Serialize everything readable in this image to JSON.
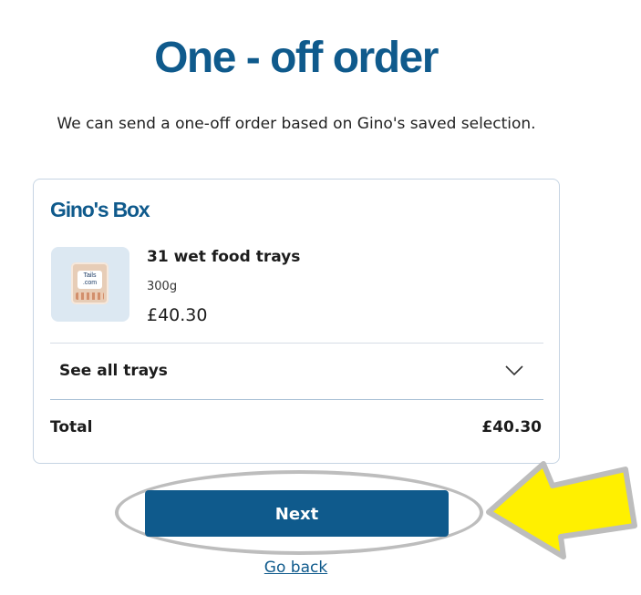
{
  "page": {
    "title": "One - off order",
    "subtitle": "We can send a one-off order based on Gino's saved selection."
  },
  "card": {
    "box_title": "Gino's Box",
    "product": {
      "name": "31 wet food trays",
      "weight": "300g",
      "price": "£40.30",
      "thumbnail_text": "Tails .com"
    },
    "see_all_label": "See all trays",
    "total_label": "Total",
    "total_value": "£40.30"
  },
  "actions": {
    "next_label": "Next",
    "go_back_label": "Go back"
  },
  "annotations": {
    "highlight_color": "#bdbdbd",
    "arrow_color": "#fff000"
  },
  "colors": {
    "brand": "#0f5a8c",
    "card_border": "#c6d4e3",
    "thumbnail_bg": "#dce8f2"
  },
  "icons": {
    "expand": "chevron-down-icon"
  }
}
